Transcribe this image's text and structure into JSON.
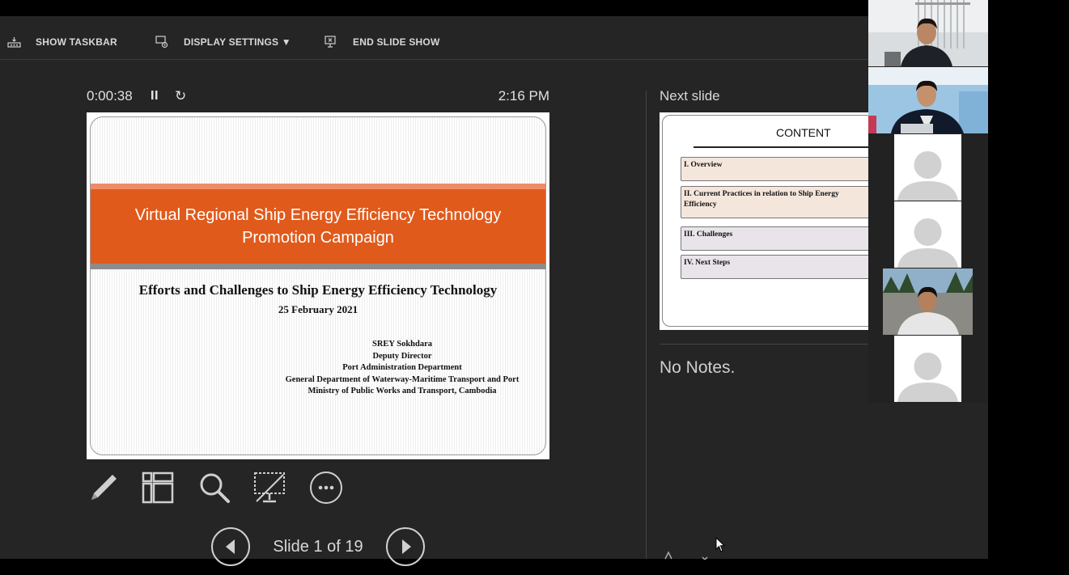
{
  "toolbar": {
    "show_taskbar": "SHOW TASKBAR",
    "display_settings": "DISPLAY SETTINGS ▼",
    "end_slide_show": "END SLIDE SHOW"
  },
  "presenter": {
    "elapsed_time": "0:00:38",
    "clock": "2:16 PM",
    "restart_glyph": "↻"
  },
  "current_slide": {
    "banner_title": "Virtual Regional Ship Energy Efficiency Technology Promotion Campaign",
    "subtitle": "Efforts and Challenges to Ship Energy Efficiency Technology",
    "date": "25 February 2021",
    "author": [
      "SREY Sokhdara",
      "Deputy Director",
      "Port Administration Department",
      "General Department of Waterway-Maritime Transport and Port",
      "Ministry of Public Works and Transport, Cambodia"
    ]
  },
  "slide_nav": {
    "counter": "Slide 1 of 19"
  },
  "next_slide": {
    "label": "Next slide",
    "title": "CONTENT",
    "items": [
      {
        "text": "I. Overview",
        "color": "#f5e6dc"
      },
      {
        "text": "II. Current Practices in relation to Ship Energy Efficiency",
        "color": "#f5e6dc"
      },
      {
        "text": "III. Challenges",
        "color": "#e9e4ea"
      },
      {
        "text": "IV. Next Steps",
        "color": "#e9e4ea"
      }
    ]
  },
  "notes": {
    "text": "No Notes."
  },
  "tools": [
    "pen-icon",
    "layout-icon",
    "zoom-icon",
    "blackout-screen-icon",
    "more-options-icon"
  ],
  "participants": [
    "participant-video-1",
    "participant-video-2",
    "participant-avatar-3",
    "participant-avatar-4",
    "participant-video-5",
    "participant-avatar-6"
  ]
}
